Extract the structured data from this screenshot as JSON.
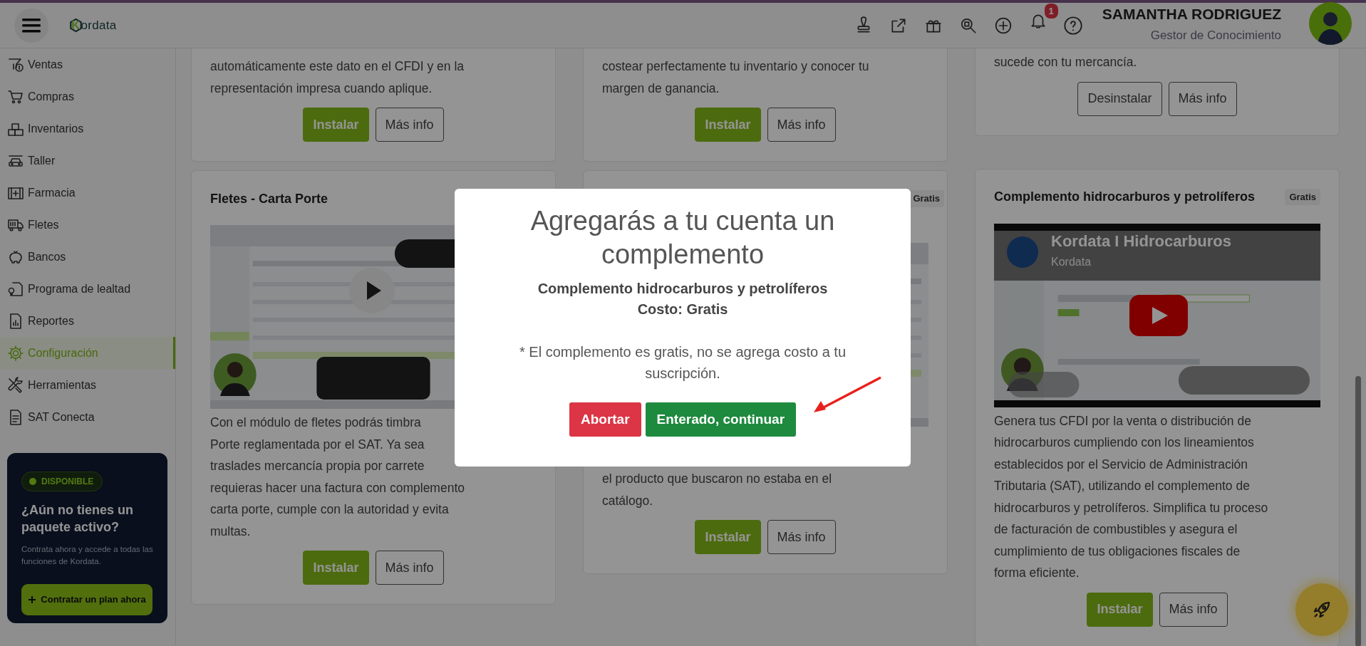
{
  "header": {
    "logo": "Kordata",
    "notification_count": "1",
    "user_name": "SAMANTHA RODRIGUEZ",
    "user_role": "Gestor de Conocimiento"
  },
  "sidebar": {
    "items": [
      {
        "label": "Ventas",
        "selected": false
      },
      {
        "label": "Compras",
        "selected": false
      },
      {
        "label": "Inventarios",
        "selected": false
      },
      {
        "label": "Taller",
        "selected": false
      },
      {
        "label": "Farmacia",
        "selected": false
      },
      {
        "label": "Fletes",
        "selected": false
      },
      {
        "label": "Bancos",
        "selected": false
      },
      {
        "label": "Programa de lealtad",
        "selected": false
      },
      {
        "label": "Reportes",
        "selected": false
      },
      {
        "label": "Configuración",
        "selected": true
      },
      {
        "label": "Herramientas",
        "selected": false
      },
      {
        "label": "SAT Conecta",
        "selected": false
      }
    ],
    "promo": {
      "badge": "DISPONIBLE",
      "title": "¿Aún no tienes un paquete activo?",
      "text": "Contrata ahora y accede a todas las funciones de Kordata.",
      "button": "Contratar un plan ahora"
    }
  },
  "columns": [
    {
      "cards": [
        {
          "lines": [
            "automáticamente este dato en el CFDI y en la",
            "representación impresa cuando aplique."
          ],
          "buttons": [
            {
              "label": "Instalar",
              "kind": "primary"
            },
            {
              "label": "Más info",
              "kind": "outline"
            }
          ]
        },
        {
          "title": "Fletes - Carta Porte",
          "video": {
            "kind": "screen-recording"
          },
          "lines": [
            "Con el módulo de fletes podrás timbra",
            "Porte reglamentada por el SAT. Ya sea",
            "traslades mercancía propia por carrete",
            "requieras hacer una factura con complemento",
            "carta porte, cumple con la autoridad y evita",
            "multas."
          ],
          "buttons": [
            {
              "label": "Instalar",
              "kind": "primary"
            },
            {
              "label": "Más info",
              "kind": "outline"
            }
          ]
        }
      ]
    },
    {
      "cards": [
        {
          "lines": [
            "costear perfectamente tu inventario y conocer tu",
            "margen de ganancia."
          ],
          "buttons": [
            {
              "label": "Instalar",
              "kind": "primary"
            },
            {
              "label": "Más info",
              "kind": "outline"
            }
          ]
        },
        {
          "badge": "Gratis",
          "video": {
            "kind": "picture"
          },
          "lines": [
            "el producto que buscaron no estaba en el",
            "catálogo."
          ],
          "buttons": [
            {
              "label": "Instalar",
              "kind": "primary"
            },
            {
              "label": "Más info",
              "kind": "outline"
            }
          ]
        }
      ]
    },
    {
      "cards": [
        {
          "lines": [
            "sucede con tu mercancía."
          ],
          "buttons": [
            {
              "label": "Desinstalar",
              "kind": "outline"
            },
            {
              "label": "Más info",
              "kind": "outline"
            }
          ]
        },
        {
          "title": "Complemento hidrocarburos y petrolíferos",
          "badge": "Gratis",
          "video": {
            "kind": "youtube",
            "title": "Kordata I Hidrocarburos",
            "channel": "Kordata"
          },
          "lines": [
            "Genera tus CFDI por la venta o distribución de",
            "hidrocarburos cumpliendo con los lineamientos",
            "establecidos por el Servicio de Administración",
            "Tributaria (SAT), utilizando el complemento de",
            "hidrocarburos y petrolíferos. Simplifica tu proceso",
            "de facturación de combustibles y asegura el",
            "cumplimiento de tus obligaciones fiscales de",
            "forma eficiente."
          ],
          "buttons": [
            {
              "label": "Instalar",
              "kind": "primary"
            },
            {
              "label": "Más info",
              "kind": "outline"
            }
          ]
        }
      ]
    }
  ],
  "modal": {
    "title": "Agregarás a tu cuenta un complemento",
    "product": "Complemento hidrocarburos y petrolíferos",
    "cost": "Costo: Gratis",
    "note": "* El complemento es gratis, no se agrega costo a tu suscripción.",
    "buttons": [
      {
        "label": "Abortar",
        "kind": "danger"
      },
      {
        "label": "Enterado, continuar",
        "kind": "success"
      }
    ]
  }
}
